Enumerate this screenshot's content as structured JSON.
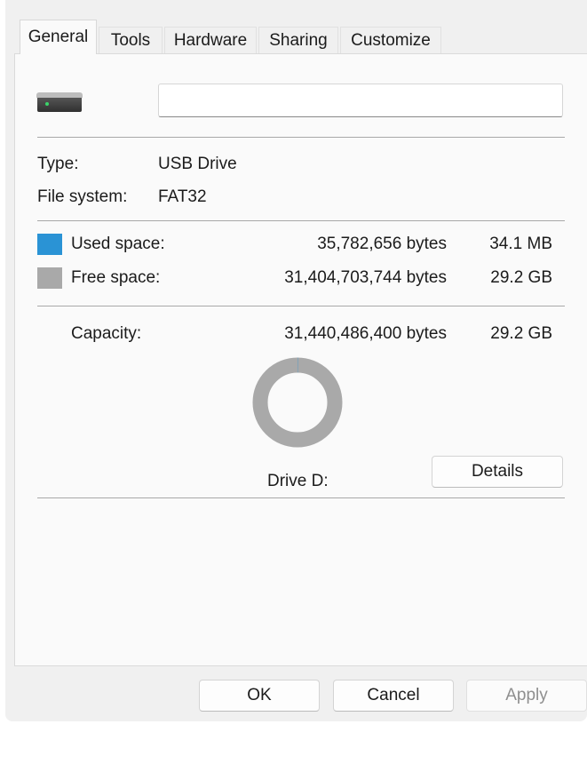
{
  "tabs": [
    "General",
    "Tools",
    "Hardware",
    "Sharing",
    "Customize"
  ],
  "name_field": {
    "value": ""
  },
  "info": {
    "type_label": "Type:",
    "type_value": "USB Drive",
    "fs_label": "File system:",
    "fs_value": "FAT32"
  },
  "space": {
    "used_label": "Used space:",
    "used_bytes": "35,782,656 bytes",
    "used_size": "34.1 MB",
    "free_label": "Free space:",
    "free_bytes": "31,404,703,744 bytes",
    "free_size": "29.2 GB",
    "capacity_label": "Capacity:",
    "capacity_bytes": "31,440,486,400 bytes",
    "capacity_size": "29.2 GB",
    "used_fraction": 0.00114
  },
  "drive_label": "Drive D:",
  "details_button": "Details",
  "footer": {
    "ok": "OK",
    "cancel": "Cancel",
    "apply": "Apply"
  },
  "colors": {
    "used": "#2a93d5",
    "free": "#a9a9a9"
  },
  "icons": {
    "drive": "usb-drive-icon"
  }
}
